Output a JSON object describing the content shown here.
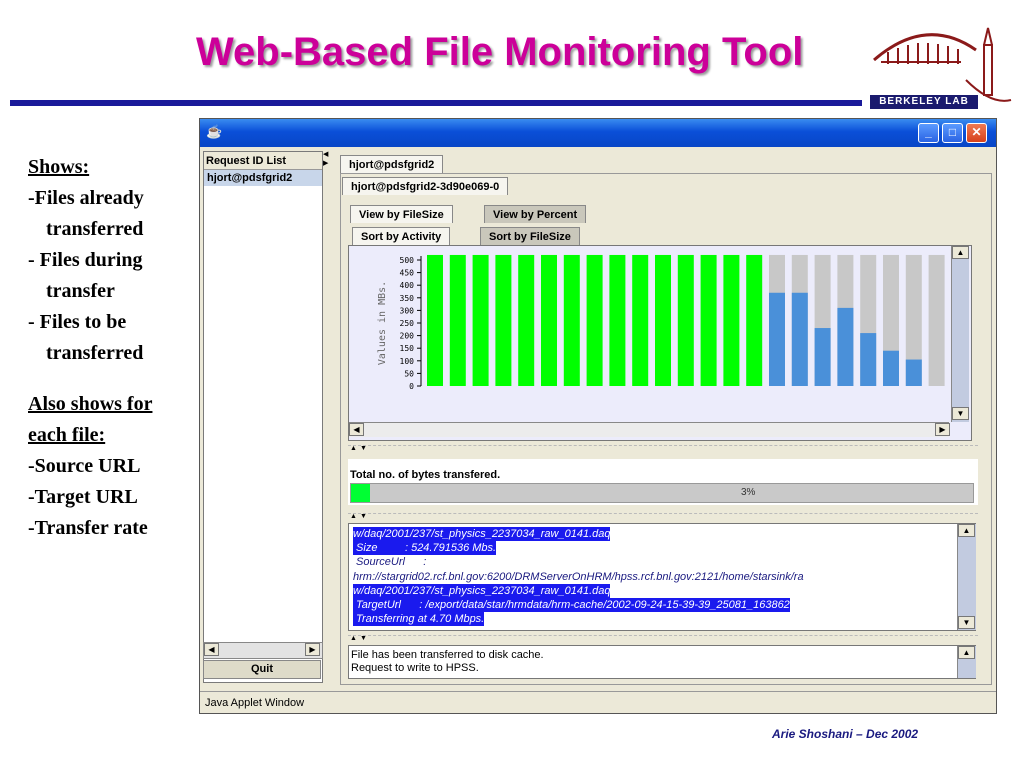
{
  "slide": {
    "title": "Web-Based File Monitoring Tool",
    "logo_text": "BERKELEY LAB",
    "footer": "Arie Shoshani – Dec 2002",
    "bullets": {
      "shows_heading": "Shows:",
      "shows": [
        "-Files already",
        "transferred",
        "- Files during",
        "transfer",
        "- Files to be",
        "transferred"
      ],
      "also_heading_1": "Also shows for",
      "also_heading_2": "each file:",
      "also": [
        "-Source URL",
        "-Target URL",
        "-Transfer rate"
      ]
    },
    "colors": {
      "title": "#cc0099",
      "rule": "#1a1a9a"
    }
  },
  "window": {
    "left_panel": {
      "header": "Request ID List",
      "items": [
        "hjort@pdsfgrid2"
      ],
      "quit_label": "Quit"
    },
    "tabs": {
      "outer": "hjort@pdsfgrid2",
      "request": "hjort@pdsfgrid2-3d90e069-0",
      "view": [
        "View by FileSize",
        "View by Percent"
      ],
      "sort": [
        "Sort by Activity",
        "Sort by FileSize"
      ]
    },
    "progress": {
      "label": "Total no. of bytes transfered.",
      "percent_text": "3%",
      "fraction": 0.03
    },
    "details": [
      {
        "text": "w/daq/2001/237/st_physics_2237034_raw_0141.daq",
        "hl": true
      },
      {
        "text": " Size         : 524.791536 Mbs.",
        "hl": true
      },
      {
        "text": " SourceUrl      :",
        "hl": false
      },
      {
        "text": "hrm://stargrid02.rcf.bnl.gov:6200/DRMServerOnHRM/hpss.rcf.bnl.gov:2121/home/starsink/ra",
        "hl": false
      },
      {
        "text": "w/daq/2001/237/st_physics_2237034_raw_0141.daq",
        "hl": true
      },
      {
        "text": " TargetUrl      : /export/data/star/hrmdata/hrm-cache/2002-09-24-15-39-39_25081_163862",
        "hl": true
      },
      {
        "text": " Transferring at 4.70 Mbps.",
        "hl": true
      }
    ],
    "messages": [
      "File has been transferred to disk cache.",
      "Request to write to HPSS."
    ],
    "status_bar": "Java Applet Window"
  },
  "chart_data": {
    "type": "bar",
    "ylabel": "Values in MBs.",
    "ylim": [
      0,
      500
    ],
    "yticks": [
      0,
      50,
      100,
      150,
      200,
      250,
      300,
      350,
      400,
      450,
      500
    ],
    "series": [
      {
        "values": [
          520,
          520,
          520,
          520,
          520,
          520,
          520,
          520,
          520,
          520,
          520,
          520,
          520,
          520,
          520,
          520,
          520,
          520,
          520,
          520,
          520,
          520,
          520,
          520,
          520,
          520
        ]
      },
      {
        "values": [
          520,
          520,
          520,
          520,
          520,
          520,
          520,
          520,
          520,
          520,
          520,
          520,
          520,
          520,
          520,
          370,
          370,
          230,
          310,
          210,
          140,
          105,
          0,
          0,
          0,
          0
        ]
      }
    ],
    "colors": {
      "complete": "#00ff00",
      "in_progress": "#4a90d9",
      "pending": "#c8c8c8"
    }
  }
}
